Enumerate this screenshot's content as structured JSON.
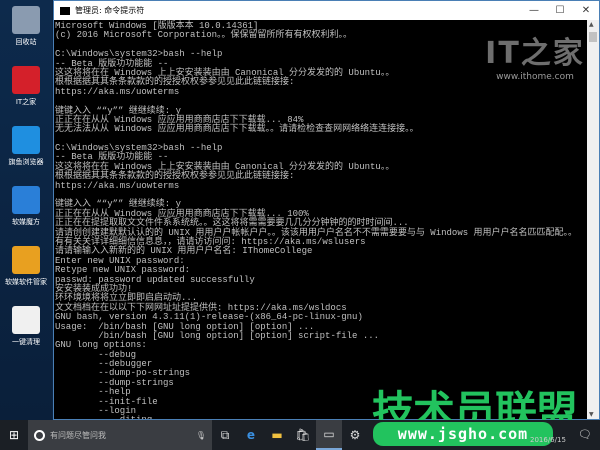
{
  "desktop": {
    "icons": [
      {
        "label": "回收站",
        "color": "#8a9bb0"
      },
      {
        "label": "IT之家",
        "color": "#d4202a"
      },
      {
        "label": "旗鱼浏览器",
        "color": "#1f8fe0"
      },
      {
        "label": "软媒魔方",
        "color": "#2a7fd8"
      },
      {
        "label": "软媒软件管家",
        "color": "#e8a020"
      },
      {
        "label": "一键清理",
        "color": "#f0f0f0"
      }
    ]
  },
  "window": {
    "title": "管理员: 命令提示符",
    "minimize": "—",
    "maximize": "☐",
    "close": "✕",
    "lines": [
      "Microsoft Windows [版版本本 10.0.14361]",
      "(c) 2016 Microsoft Corporation。。保保留留所所有有权权利利。。",
      "",
      "C:\\Windows\\system32>bash --help",
      "-- Beta 版版功功能能 --",
      "这这将将在在 Windows 上上安安装装由由 Canonical 分分发发的的 Ubuntu。。",
      "根根据据其其条条款款的的授授权权参参见见此此链链接接:",
      "https://aka.ms/uowterms",
      "",
      "键键入入 ““y”” 继继续续: y",
      "正正在在从从 Windows 应应用用商商店店下下载载... 84%",
      "无无法法从从 Windows 应应用用商商店店下下载载。。请请检检查查网网络络连连接接。。",
      "",
      "C:\\Windows\\system32>bash --help",
      "-- Beta 版版功功能能 --",
      "这这将将在在 Windows 上上安安装装由由 Canonical 分分发发的的 Ubuntu。。",
      "根根据据其其条条款款的的授授权权参参见见此此链链接接:",
      "https://aka.ms/uowterms",
      "",
      "键键入入 ““y”” 继继续续: y",
      "正正在在从从 Windows 应应用用商商店店下下载载... 100%",
      "正正在在提提取取文文件件系系统统。。这这将将需需要要几几分分钟钟的的时时间间...",
      "请请创创建建默默认认的的 UNIX 用用户户帐帐户户。。该该用用户户名名不不需需要要与与 Windows 用用户户名名匹匹配配。。",
      "有有关关详详细细信信息息，，请请访访问问: https://aka.ms/wslusers",
      "请请输输入入新新的的 UNIX 用用户户名名: IThomeCollege",
      "Enter new UNIX password:",
      "Retype new UNIX password:",
      "passwd: password updated successfully",
      "安安装装成成功功!",
      "环环境境将将立立即即启启动动...",
      "文文档档在在以以下下网网址址提提供供: https://aka.ms/wsldocs",
      "GNU bash, version 4.3.11(1)-release-(x86_64-pc-linux-gnu)",
      "Usage:  /bin/bash [GNU long option] [option] ...",
      "        /bin/bash [GNU long option] [option] script-file ...",
      "GNU long options:",
      "        --debug",
      "        --debugger",
      "        --dump-po-strings",
      "        --dump-strings",
      "        --help",
      "        --init-file",
      "        --login",
      "            diting"
    ]
  },
  "watermarks": {
    "ithome_logo": "IT之家",
    "ithome_url": "www.ithome.com",
    "jsgho_text": "技术员联盟",
    "jsgho_url": "www.jsgho.com"
  },
  "taskbar": {
    "search_placeholder": "有问题尽管问我",
    "date": "2016/6/15",
    "notification_count": "2"
  }
}
